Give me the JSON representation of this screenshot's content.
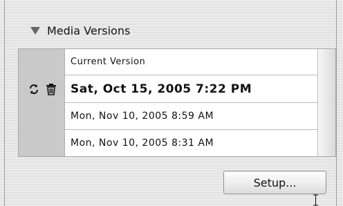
{
  "panel": {
    "title": "Media Versions"
  },
  "versions": {
    "header_label": "Current Version",
    "items": [
      {
        "label": "Sat, Oct 15, 2005 7:22 PM",
        "selected": true,
        "icons": [
          "revert-icon",
          "trash-icon"
        ]
      },
      {
        "label": "Mon, Nov 10, 2005 8:59 AM",
        "selected": false
      },
      {
        "label": "Mon, Nov 10, 2005 8:31 AM",
        "selected": false
      }
    ]
  },
  "buttons": {
    "setup_label": "Setup..."
  },
  "colors": {
    "panel_bg": "#ececec",
    "icon_column_bg": "#c9c9c9",
    "list_bg": "#ffffff"
  }
}
